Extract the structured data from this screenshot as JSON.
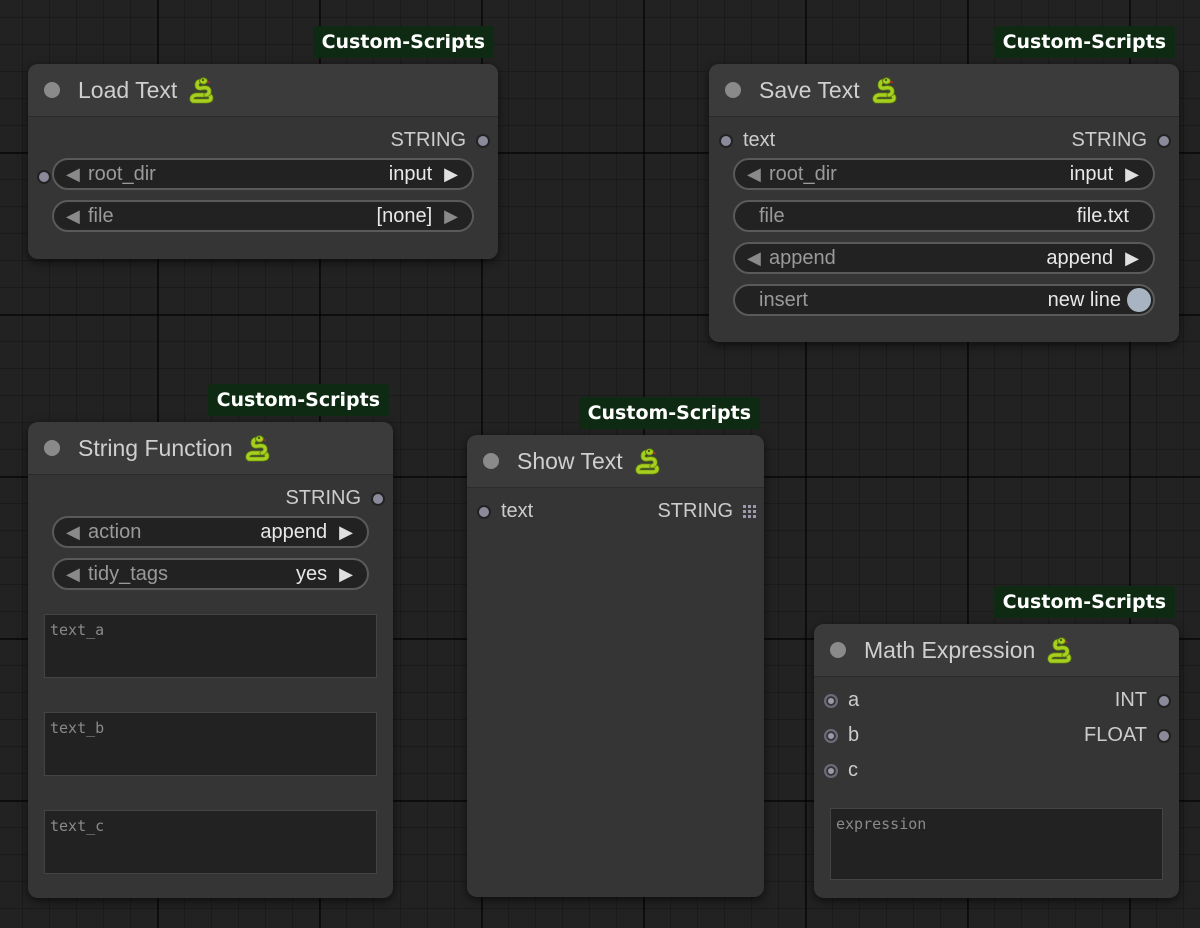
{
  "badge_label": "Custom-Scripts",
  "colors": {
    "snake": "#9cc21a",
    "badge_bg": "#0e2a12",
    "node_bg": "#353535"
  },
  "icons": {
    "title": "snake-icon",
    "status": "node-status-dot"
  },
  "load_text": {
    "title": "Load Text",
    "output": "STRING",
    "widgets": [
      {
        "label": "root_dir",
        "value": "input"
      },
      {
        "label": "file",
        "value": "[none]"
      }
    ]
  },
  "save_text": {
    "title": "Save Text",
    "input": "text",
    "output": "STRING",
    "widgets": [
      {
        "label": "root_dir",
        "value": "input"
      },
      {
        "label": "file",
        "value": "file.txt"
      },
      {
        "label": "append",
        "value": "append"
      },
      {
        "label": "insert",
        "value": "new line"
      }
    ]
  },
  "string_function": {
    "title": "String Function",
    "output": "STRING",
    "widgets": [
      {
        "label": "action",
        "value": "append"
      },
      {
        "label": "tidy_tags",
        "value": "yes"
      }
    ],
    "textareas": [
      {
        "placeholder": "text_a"
      },
      {
        "placeholder": "text_b"
      },
      {
        "placeholder": "text_c"
      }
    ]
  },
  "show_text": {
    "title": "Show Text",
    "input": "text",
    "output": "STRING"
  },
  "math_expression": {
    "title": "Math Expression",
    "inputs": [
      "a",
      "b",
      "c"
    ],
    "outputs": [
      "INT",
      "FLOAT"
    ],
    "textarea": {
      "placeholder": "expression"
    }
  }
}
